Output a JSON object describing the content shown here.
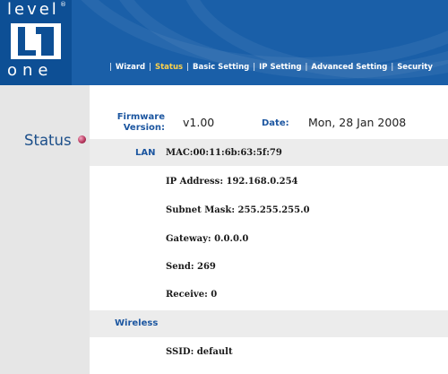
{
  "logo": {
    "top_text": "level",
    "bottom_text": "one",
    "registered": "®"
  },
  "nav": {
    "separator": "|",
    "items": [
      {
        "label": "Wizard",
        "active": false
      },
      {
        "label": "Status",
        "active": true
      },
      {
        "label": "Basic Setting",
        "active": false
      },
      {
        "label": "IP Setting",
        "active": false
      },
      {
        "label": "Advanced Setting",
        "active": false
      },
      {
        "label": "Security",
        "active": false
      }
    ]
  },
  "sidebar": {
    "title": "Status"
  },
  "info": {
    "firmware_label_line1": "Firmware",
    "firmware_label_line2": "Version:",
    "firmware_value": "v1.00",
    "date_label": "Date:",
    "date_value": "Mon, 28 Jan 2008"
  },
  "lan": {
    "label": "LAN",
    "mac": "MAC:00:11:6b:63:5f:79",
    "ip": "IP Address: 192.168.0.254",
    "subnet": "Subnet Mask: 255.255.255.0",
    "gateway": "Gateway: 0.0.0.0",
    "send": "Send: 269",
    "receive": "Receive: 0"
  },
  "wireless": {
    "label": "Wireless",
    "ssid": "SSID: default"
  },
  "colors": {
    "header_blue": "#1a5fa8",
    "logo_blue": "#0d4f95",
    "active_nav": "#ffd24a",
    "label_blue": "#1c56a0",
    "sidebar_gray": "#e6e6e6",
    "strip_gray": "#ececec"
  }
}
